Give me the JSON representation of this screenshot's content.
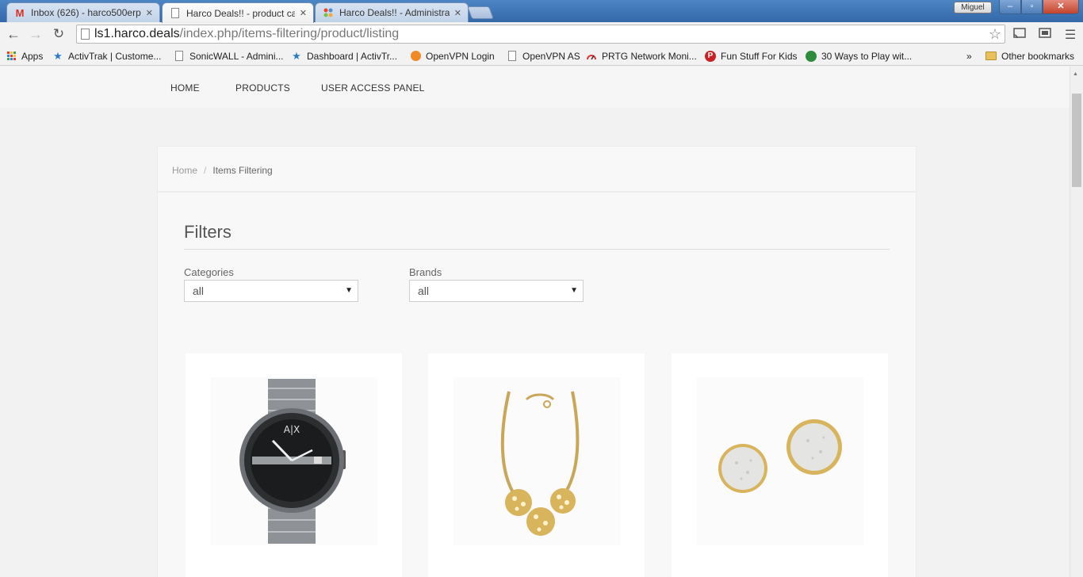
{
  "browser": {
    "tabs": [
      {
        "title": "Inbox (626) - harco500erp",
        "icon": "gmail-icon",
        "close": "✕"
      },
      {
        "title": "Harco Deals!! - product ca",
        "icon": "page-icon",
        "close": "✕"
      },
      {
        "title": "Harco Deals!! - Administra",
        "icon": "joomla-icon",
        "close": "✕"
      }
    ],
    "user_name": "Miguel",
    "url_host": "ls1.harco.deals",
    "url_path": "/index.php/items-filtering/product/listing",
    "bookmarks": [
      {
        "label": "Apps",
        "icon": "apps-grid-icon"
      },
      {
        "label": "ActivTrak | Custome...",
        "icon": "activtrak-icon"
      },
      {
        "label": "SonicWALL - Admini...",
        "icon": "page-icon"
      },
      {
        "label": "Dashboard | ActivTr...",
        "icon": "activtrak-icon"
      },
      {
        "label": "OpenVPN Login",
        "icon": "openvpn-icon"
      },
      {
        "label": "OpenVPN AS",
        "icon": "page-icon"
      },
      {
        "label": "PRTG Network Moni...",
        "icon": "prtg-icon"
      },
      {
        "label": "Fun Stuff For Kids",
        "icon": "pinterest-icon"
      },
      {
        "label": "30 Ways to Play wit...",
        "icon": "site-icon"
      }
    ],
    "bookmarks_overflow": "»",
    "other_bookmarks": "Other bookmarks"
  },
  "site": {
    "nav": [
      "HOME",
      "PRODUCTS",
      "USER ACCESS PANEL"
    ],
    "breadcrumb": {
      "home": "Home",
      "separator": "/",
      "current": "Items Filtering"
    },
    "filters_title": "Filters",
    "filters": {
      "categories": {
        "label": "Categories",
        "value": "all"
      },
      "brands": {
        "label": "Brands",
        "value": "all"
      }
    },
    "products": [
      {
        "image": "watch-image"
      },
      {
        "image": "necklace-image"
      },
      {
        "image": "earrings-image"
      }
    ]
  },
  "colors": {
    "titlebar": "#3d73b4",
    "page_bg": "#f2f2f2",
    "panel_bg": "#f8f8f8",
    "gold": "#d8b45c",
    "steel": "#8e9297"
  }
}
